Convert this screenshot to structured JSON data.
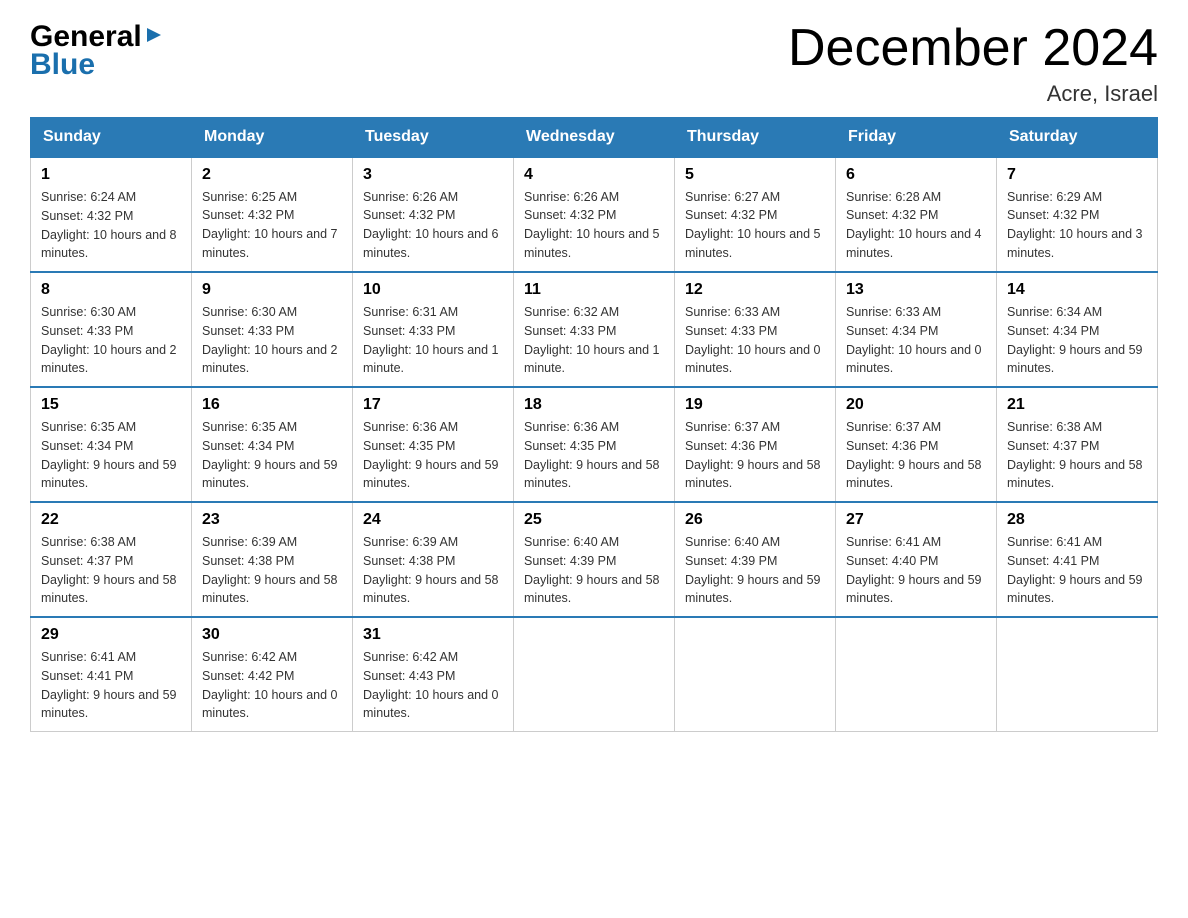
{
  "header": {
    "logo": {
      "general": "General",
      "blue": "Blue"
    },
    "title": "December 2024",
    "location": "Acre, Israel"
  },
  "days_of_week": [
    "Sunday",
    "Monday",
    "Tuesday",
    "Wednesday",
    "Thursday",
    "Friday",
    "Saturday"
  ],
  "weeks": [
    [
      {
        "day": "1",
        "sunrise": "6:24 AM",
        "sunset": "4:32 PM",
        "daylight": "10 hours and 8 minutes."
      },
      {
        "day": "2",
        "sunrise": "6:25 AM",
        "sunset": "4:32 PM",
        "daylight": "10 hours and 7 minutes."
      },
      {
        "day": "3",
        "sunrise": "6:26 AM",
        "sunset": "4:32 PM",
        "daylight": "10 hours and 6 minutes."
      },
      {
        "day": "4",
        "sunrise": "6:26 AM",
        "sunset": "4:32 PM",
        "daylight": "10 hours and 5 minutes."
      },
      {
        "day": "5",
        "sunrise": "6:27 AM",
        "sunset": "4:32 PM",
        "daylight": "10 hours and 5 minutes."
      },
      {
        "day": "6",
        "sunrise": "6:28 AM",
        "sunset": "4:32 PM",
        "daylight": "10 hours and 4 minutes."
      },
      {
        "day": "7",
        "sunrise": "6:29 AM",
        "sunset": "4:32 PM",
        "daylight": "10 hours and 3 minutes."
      }
    ],
    [
      {
        "day": "8",
        "sunrise": "6:30 AM",
        "sunset": "4:33 PM",
        "daylight": "10 hours and 2 minutes."
      },
      {
        "day": "9",
        "sunrise": "6:30 AM",
        "sunset": "4:33 PM",
        "daylight": "10 hours and 2 minutes."
      },
      {
        "day": "10",
        "sunrise": "6:31 AM",
        "sunset": "4:33 PM",
        "daylight": "10 hours and 1 minute."
      },
      {
        "day": "11",
        "sunrise": "6:32 AM",
        "sunset": "4:33 PM",
        "daylight": "10 hours and 1 minute."
      },
      {
        "day": "12",
        "sunrise": "6:33 AM",
        "sunset": "4:33 PM",
        "daylight": "10 hours and 0 minutes."
      },
      {
        "day": "13",
        "sunrise": "6:33 AM",
        "sunset": "4:34 PM",
        "daylight": "10 hours and 0 minutes."
      },
      {
        "day": "14",
        "sunrise": "6:34 AM",
        "sunset": "4:34 PM",
        "daylight": "9 hours and 59 minutes."
      }
    ],
    [
      {
        "day": "15",
        "sunrise": "6:35 AM",
        "sunset": "4:34 PM",
        "daylight": "9 hours and 59 minutes."
      },
      {
        "day": "16",
        "sunrise": "6:35 AM",
        "sunset": "4:34 PM",
        "daylight": "9 hours and 59 minutes."
      },
      {
        "day": "17",
        "sunrise": "6:36 AM",
        "sunset": "4:35 PM",
        "daylight": "9 hours and 59 minutes."
      },
      {
        "day": "18",
        "sunrise": "6:36 AM",
        "sunset": "4:35 PM",
        "daylight": "9 hours and 58 minutes."
      },
      {
        "day": "19",
        "sunrise": "6:37 AM",
        "sunset": "4:36 PM",
        "daylight": "9 hours and 58 minutes."
      },
      {
        "day": "20",
        "sunrise": "6:37 AM",
        "sunset": "4:36 PM",
        "daylight": "9 hours and 58 minutes."
      },
      {
        "day": "21",
        "sunrise": "6:38 AM",
        "sunset": "4:37 PM",
        "daylight": "9 hours and 58 minutes."
      }
    ],
    [
      {
        "day": "22",
        "sunrise": "6:38 AM",
        "sunset": "4:37 PM",
        "daylight": "9 hours and 58 minutes."
      },
      {
        "day": "23",
        "sunrise": "6:39 AM",
        "sunset": "4:38 PM",
        "daylight": "9 hours and 58 minutes."
      },
      {
        "day": "24",
        "sunrise": "6:39 AM",
        "sunset": "4:38 PM",
        "daylight": "9 hours and 58 minutes."
      },
      {
        "day": "25",
        "sunrise": "6:40 AM",
        "sunset": "4:39 PM",
        "daylight": "9 hours and 58 minutes."
      },
      {
        "day": "26",
        "sunrise": "6:40 AM",
        "sunset": "4:39 PM",
        "daylight": "9 hours and 59 minutes."
      },
      {
        "day": "27",
        "sunrise": "6:41 AM",
        "sunset": "4:40 PM",
        "daylight": "9 hours and 59 minutes."
      },
      {
        "day": "28",
        "sunrise": "6:41 AM",
        "sunset": "4:41 PM",
        "daylight": "9 hours and 59 minutes."
      }
    ],
    [
      {
        "day": "29",
        "sunrise": "6:41 AM",
        "sunset": "4:41 PM",
        "daylight": "9 hours and 59 minutes."
      },
      {
        "day": "30",
        "sunrise": "6:42 AM",
        "sunset": "4:42 PM",
        "daylight": "10 hours and 0 minutes."
      },
      {
        "day": "31",
        "sunrise": "6:42 AM",
        "sunset": "4:43 PM",
        "daylight": "10 hours and 0 minutes."
      },
      null,
      null,
      null,
      null
    ]
  ],
  "labels": {
    "sunrise": "Sunrise:",
    "sunset": "Sunset:",
    "daylight": "Daylight:"
  }
}
